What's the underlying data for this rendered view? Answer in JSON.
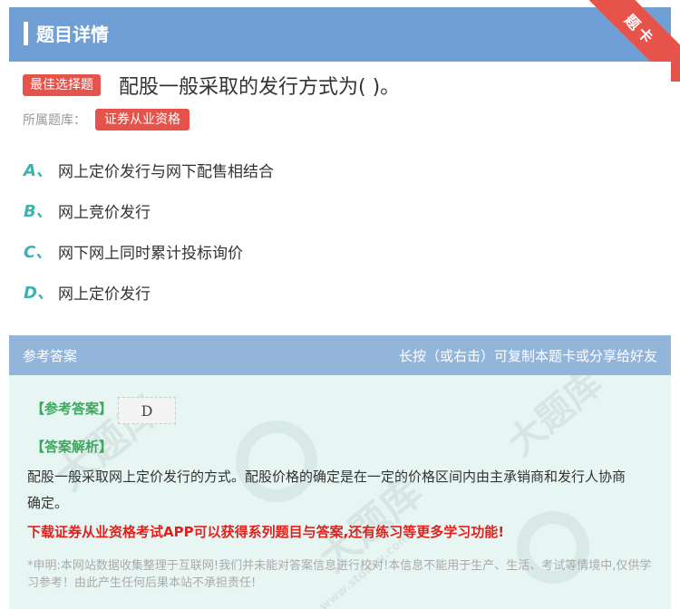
{
  "header": {
    "title": "题目详情"
  },
  "ribbon": {
    "label": "题卡"
  },
  "question": {
    "type_tag": "最佳选择题",
    "text": "配股一般采取的发行方式为( )。",
    "bank_label": "所属题库：",
    "bank_tag": "证券从业资格",
    "options": [
      {
        "letter": "A、",
        "text": "网上定价发行与网下配售相结合"
      },
      {
        "letter": "B、",
        "text": "网上竞价发行"
      },
      {
        "letter": "C、",
        "text": "网下网上同时累计投标询价"
      },
      {
        "letter": "D、",
        "text": "网上定价发行"
      }
    ]
  },
  "answer": {
    "head_left": "参考答案",
    "head_right": "长按（或右击）可复制本题卡或分享给好友",
    "ref_label": "【参考答案】",
    "ref_value": "D",
    "analysis_label": "【答案解析】",
    "analysis_text": "配股一般采取网上定价发行的方式。配股价格的确定是在一定的价格区间内由主承销商和发行人协商确定。",
    "promo": "下载证券从业资格考试APP可以获得系列题目与答案,还有练习等更多学习功能!",
    "disclaimer": "*申明:本网站数据收集整理于互联网!我们并未能对答案信息进行校对!本信息不能用于生产、生活、考试等情境中,仅供学习参考！由此产生任何后果本站不承担责任!"
  },
  "watermark": {
    "text": "大题库",
    "url": "www.stdaku.com"
  },
  "colors": {
    "header": "#6f9fd4",
    "accent_red": "#e5534b",
    "option_letter": "#3bb4b0",
    "answer_label": "#3aa85e",
    "promo": "#e0211d"
  }
}
